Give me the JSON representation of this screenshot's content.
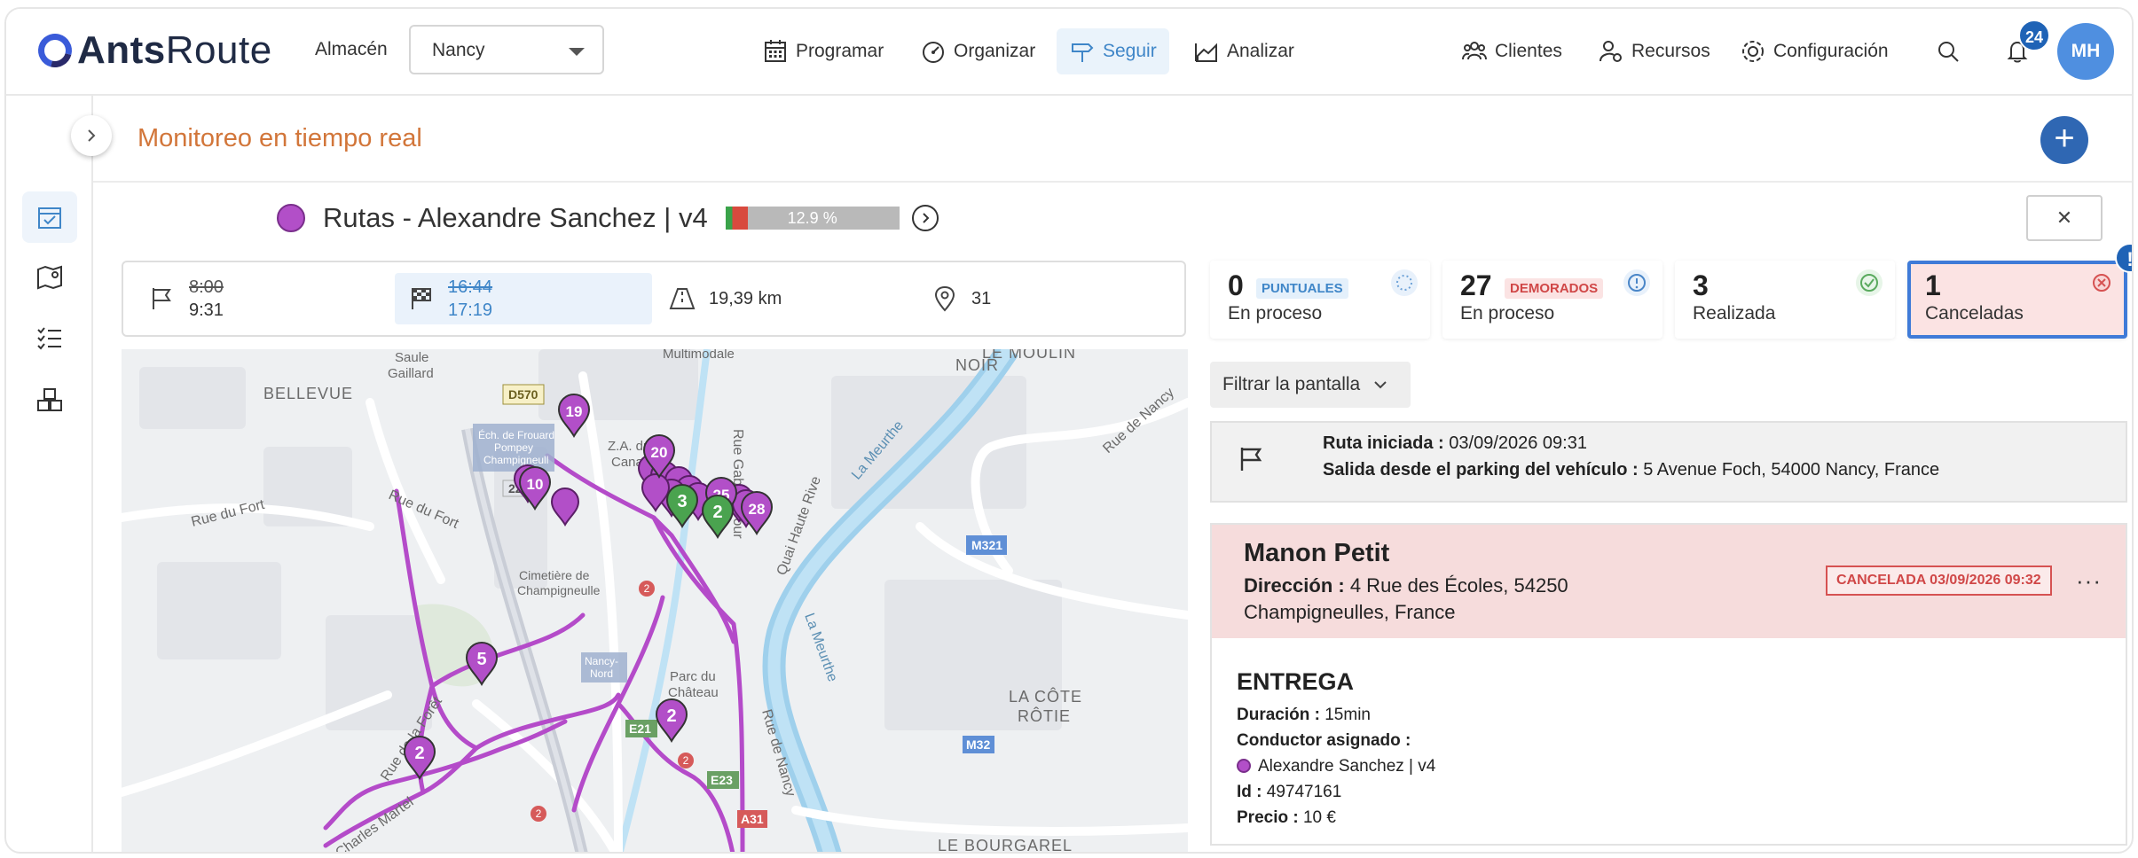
{
  "brand": {
    "name_bold": "Ants",
    "name_rest": "Route"
  },
  "warehouse": {
    "label": "Almacén",
    "value": "Nancy"
  },
  "nav": {
    "programar": "Programar",
    "organizar": "Organizar",
    "seguir": "Seguir",
    "analizar": "Analizar",
    "clientes": "Clientes",
    "recursos": "Recursos",
    "configuracion": "Configuración"
  },
  "notifications": {
    "count": "24"
  },
  "user": {
    "initials": "MH"
  },
  "page": {
    "title": "Monitoreo en tiempo real"
  },
  "route": {
    "name": "Rutas - Alexandre Sanchez | v4",
    "progress_label": "12.9 %",
    "progress_value": 0.129,
    "color": "#b24fc8"
  },
  "info": {
    "start_planned": "8:00",
    "start_actual": "9:31",
    "end_planned": "16:44",
    "end_actual": "17:19",
    "distance": "19,39 km",
    "stops": "31"
  },
  "stats": [
    {
      "num": "0",
      "tag": "PUNTUALES",
      "label": "En proceso",
      "tag_color": "#3f86c8",
      "tag_bg": "#e4f0fb"
    },
    {
      "num": "27",
      "tag": "DEMORADOS",
      "label": "En proceso",
      "tag_color": "#d04747",
      "tag_bg": "#fbe3e3"
    },
    {
      "num": "3",
      "tag": "",
      "label": "Realizada"
    },
    {
      "num": "1",
      "tag": "",
      "label": "Canceladas"
    }
  ],
  "alert_badge": "!",
  "filter": {
    "label": "Filtrar la pantalla"
  },
  "started": {
    "label1": "Ruta iniciada :",
    "value1": "03/09/2026 09:31",
    "label2": "Salida desde el parking del vehículo :",
    "value2": "5 Avenue Foch, 54000 Nancy, France"
  },
  "order": {
    "customer": "Manon Petit",
    "address_label": "Dirección :",
    "address_line1": "4 Rue des Écoles, 54250",
    "address_line2": "Champigneulles, France",
    "status": "CANCELADA 03/09/2026 09:32",
    "type": "ENTREGA",
    "duration_label": "Duración :",
    "duration": "15min",
    "driver_label": "Conductor asignado :",
    "driver": "Alexandre Sanchez | v4",
    "id_label": "Id :",
    "id": "49747161",
    "price_label": "Precio :",
    "price": "10 €"
  },
  "map": {
    "places": [
      "BELLEVUE",
      "Saule Gaillard",
      "Z.A. du Canal",
      "Rue Gabriel Bour",
      "Quai Haute Rive",
      "La Meurthe",
      "La Meurthe",
      "NOIR",
      "Rue de Nancy",
      "Rue du Fort",
      "Rue du Fort",
      "Cimetière de Champigneulle",
      "Parc du Château",
      "Rue de la Forêt",
      "Charles Martel",
      "LA CÔTE RÔTIE",
      "LE BOURGAREL",
      "Rue de Nancy",
      "Multimodale",
      "LE MOULIN",
      "Éch. de Frouard Pompey Champigneull",
      "Nancy-Nord"
    ],
    "road_badges": [
      "D570",
      "22",
      "M321",
      "E21",
      "E23",
      "M32",
      "A31"
    ],
    "pins": [
      {
        "label": "19",
        "color": "#b24fc8"
      },
      {
        "label": "20",
        "color": "#b24fc8"
      },
      {
        "label": "10",
        "color": "#b24fc8"
      },
      {
        "label": "25",
        "color": "#b24fc8"
      },
      {
        "label": "28",
        "color": "#b24fc8"
      },
      {
        "label": "3",
        "color": "#4aa34f"
      },
      {
        "label": "2",
        "color": "#4aa34f"
      },
      {
        "label": "5",
        "color": "#b24fc8"
      },
      {
        "label": "2",
        "color": "#b24fc8"
      },
      {
        "label": "2",
        "color": "#b24fc8"
      }
    ]
  }
}
